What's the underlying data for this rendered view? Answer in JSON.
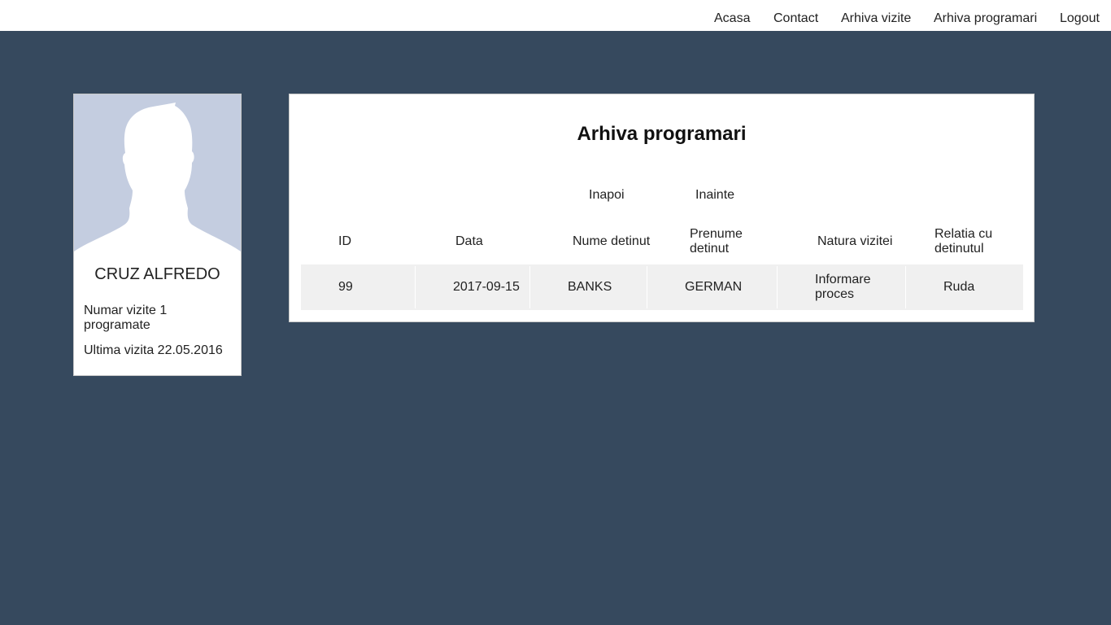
{
  "nav": {
    "items": [
      {
        "label": "Acasa"
      },
      {
        "label": "Contact"
      },
      {
        "label": "Arhiva vizite"
      },
      {
        "label": "Arhiva programari"
      },
      {
        "label": "Logout"
      }
    ]
  },
  "profile": {
    "name": "CRUZ ALFREDO",
    "visits_line_1": "Numar vizite 1",
    "visits_line_2": "programate",
    "last_visit": "Ultima vizita 22.05.2016",
    "avatar_icon": "user-silhouette-icon"
  },
  "panel": {
    "title": "Arhiva programari",
    "pager": {
      "prev": "Inapoi",
      "next": "Inainte"
    },
    "columns": {
      "id": "ID",
      "data": "Data",
      "nume": "Nume detinut",
      "prenume_1": "Prenume",
      "prenume_2": "detinut",
      "natura": "Natura vizitei",
      "relatia_1": "Relatia cu",
      "relatia_2": "detinutul"
    },
    "rows": [
      {
        "id": "99",
        "data": "2017-09-15",
        "nume": "BANKS",
        "prenume": "GERMAN",
        "natura_1": "Informare",
        "natura_2": "proces",
        "relatia": "Ruda"
      }
    ]
  },
  "colors": {
    "background": "#36495e",
    "panel": "#ffffff",
    "row": "#f0f0f0",
    "avatar_bg": "#c4cde0"
  }
}
